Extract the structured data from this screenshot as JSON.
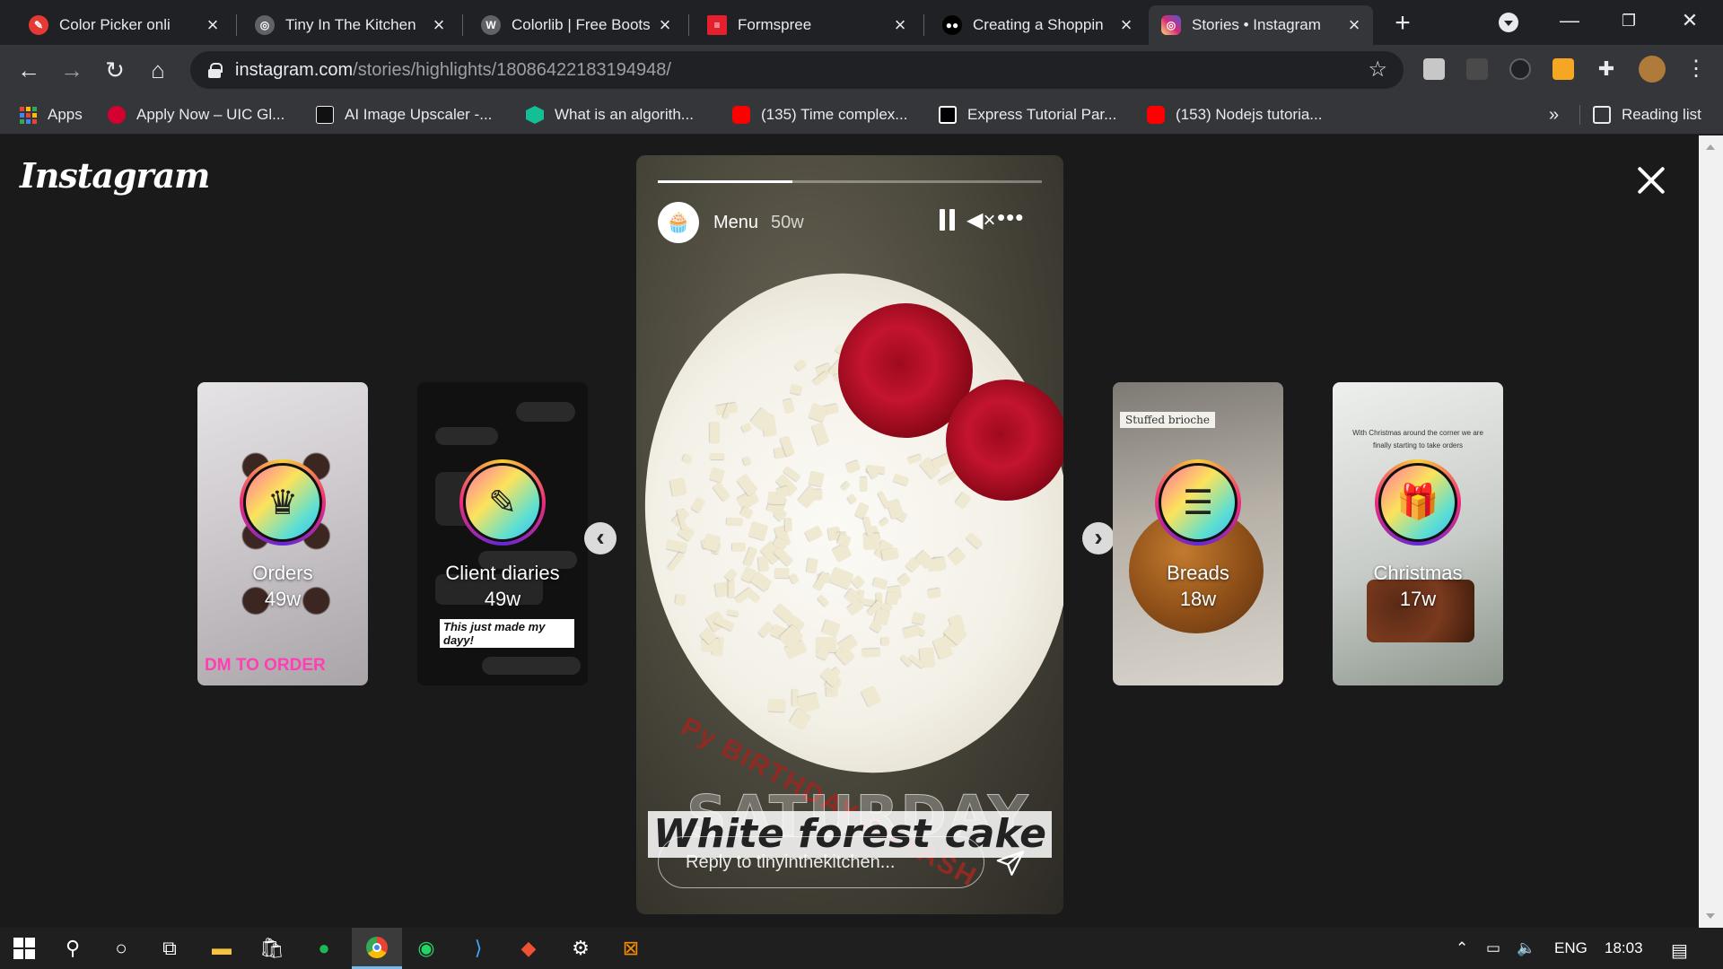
{
  "tabs": [
    {
      "title": "Color Picker onli",
      "favicon": "color-picker-icon",
      "color": "#e53935"
    },
    {
      "title": "Tiny In The Kitchen",
      "favicon": "globe-icon",
      "color": "#5f6368"
    },
    {
      "title": "Colorlib | Free Boots",
      "favicon": "wordpress-icon",
      "color": "#5f6368"
    },
    {
      "title": "Formspree",
      "favicon": "formspree-icon",
      "color": "#e5202e"
    },
    {
      "title": "Creating a Shoppin",
      "favicon": "medium-icon",
      "color": "#000000"
    },
    {
      "title": "Stories • Instagram",
      "favicon": "instagram-icon",
      "color": "#d6249f"
    }
  ],
  "url": {
    "host": "instagram.com",
    "path": "/stories/highlights/18086422183194948/"
  },
  "bookmarks": [
    {
      "label": "Apps",
      "icon": "apps-grid-icon"
    },
    {
      "label": "Apply Now – UIC Gl...",
      "icon": "uic-icon",
      "color": "#d50032"
    },
    {
      "label": "AI Image Upscaler -...",
      "icon": "upscaler-icon",
      "color": "#111111"
    },
    {
      "label": "What is an algorith...",
      "icon": "khan-icon",
      "color": "#14bf96"
    },
    {
      "label": "(135) Time complex...",
      "icon": "youtube-icon",
      "color": "#ff0000"
    },
    {
      "label": "Express Tutorial Par...",
      "icon": "mdn-icon",
      "color": "#000000"
    },
    {
      "label": "(153) Nodejs tutoria...",
      "icon": "youtube-icon",
      "color": "#ff0000"
    }
  ],
  "reading_list": "Reading list",
  "more_bookmarks": "»",
  "instagram": {
    "logo": "Instagram",
    "highlights": [
      {
        "label": "Orders",
        "age": "49w",
        "icon": "cupcake-icon",
        "tag": "DM TO ORDER"
      },
      {
        "label": "Client diaries",
        "age": "49w",
        "icon": "chat-icon",
        "tag": "This just made my dayy!"
      },
      {
        "label": "Breads",
        "age": "18w",
        "icon": "bread-icon",
        "tag": "Stuffed brioche"
      },
      {
        "label": "Christmas",
        "age": "17w",
        "icon": "gift-icon",
        "tag": "With Christmas around the corner we are finally starting to take orders"
      }
    ],
    "story": {
      "name": "Menu",
      "time": "50w",
      "progress": 0.35,
      "caption": "White forest cake",
      "caption_bg": "SATURDAY",
      "board_text": "Py BIRTHDAY AAKASH",
      "reply_placeholder": "Reply to tinyinthekitchen..."
    }
  },
  "taskbar": {
    "lang": "ENG",
    "time": "18:03"
  }
}
